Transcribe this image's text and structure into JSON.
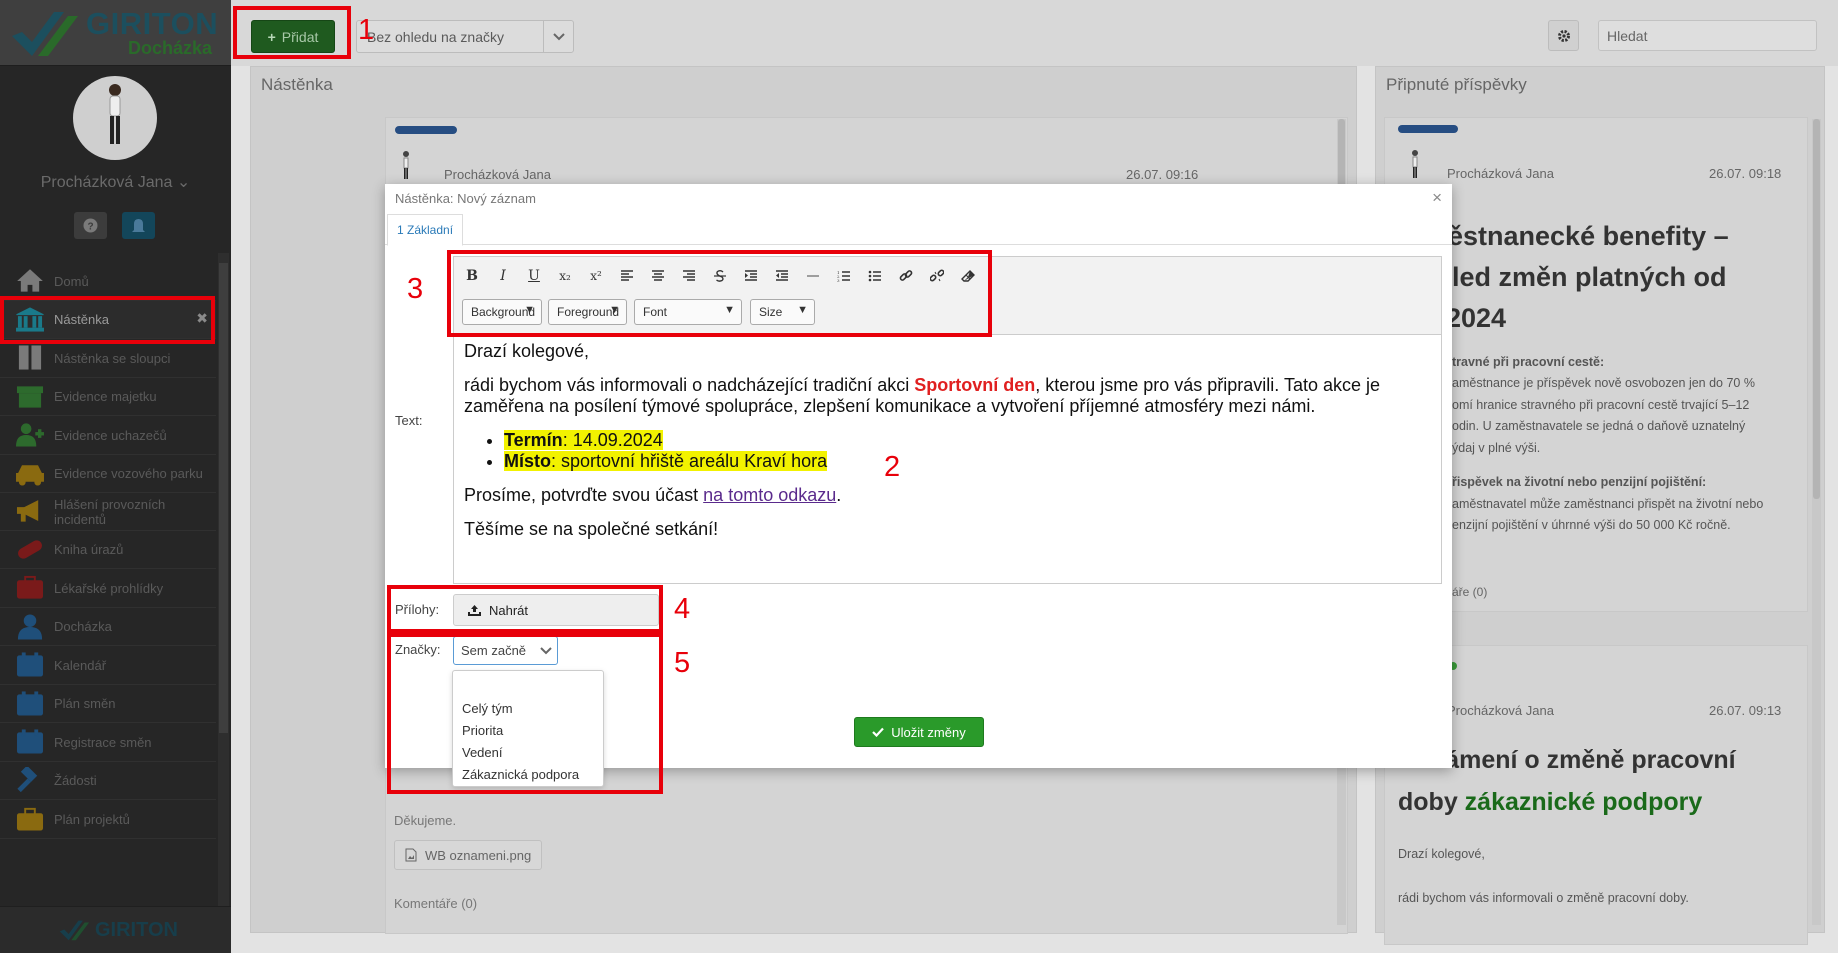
{
  "app": {
    "logo_name": "GIRITON",
    "logo_sub": "Docházka",
    "footer_logo": "GIRITON"
  },
  "user": {
    "name": "Procházková Jana",
    "chevron": "⌄"
  },
  "sidebar": {
    "items": [
      {
        "label": "Domů",
        "icon": "home-icon",
        "color": "#7a7a7a"
      },
      {
        "label": "Nástěnka",
        "icon": "bank-icon",
        "color": "#1a7a8a"
      },
      {
        "label": "Nástěnka se sloupci",
        "icon": "columns-icon",
        "color": "#7a7a7a"
      },
      {
        "label": "Evidence majetku",
        "icon": "box-icon",
        "color": "#2d6a2d"
      },
      {
        "label": "Evidence uchazečů",
        "icon": "user-add-icon",
        "color": "#2d6a2d"
      },
      {
        "label": "Evidence vozového parku",
        "icon": "car-icon",
        "color": "#8a6a10"
      },
      {
        "label": "Hlášení provozních incidentů",
        "icon": "megaphone-icon",
        "color": "#8a6a10"
      },
      {
        "label": "Kniha úrazů",
        "icon": "bandage-icon",
        "color": "#7a1a1a"
      },
      {
        "label": "Lékařské prohlídky",
        "icon": "medkit-icon",
        "color": "#7a1a1a"
      },
      {
        "label": "Docházka",
        "icon": "user-icon",
        "color": "#1f4f7a"
      },
      {
        "label": "Kalendář",
        "icon": "calendar-icon",
        "color": "#1f4f7a"
      },
      {
        "label": "Plán směn",
        "icon": "calendar-grid-icon",
        "color": "#1f4f7a"
      },
      {
        "label": "Registrace směn",
        "icon": "calendar-check-icon",
        "color": "#1f4f7a"
      },
      {
        "label": "Žádosti",
        "icon": "gavel-icon",
        "color": "#1f4f7a"
      },
      {
        "label": "Plán projektů",
        "icon": "briefcase-icon",
        "color": "#8a6a10"
      }
    ],
    "active_close": "✖"
  },
  "topbar": {
    "add_label": "Přidat",
    "tag_filter": "Bez ohledu na značky",
    "search_placeholder": "Hledat"
  },
  "board": {
    "title": "Nástěnka",
    "post": {
      "author": "Procházková Jana",
      "date": "26.07. 09:16"
    },
    "footer_line": "Děkujeme.",
    "attachment": "WB oznameni.png",
    "comments": "Komentáře (0)"
  },
  "pinned": {
    "title": "Připnuté příspěvky",
    "post1": {
      "author": "Procházková Jana",
      "date": "26.07. 09:18",
      "heading_lines": [
        "ěstnanecké benefity –",
        "led změn platných od",
        "2024"
      ],
      "p1_title": "travné při pracovní cestě:",
      "p1_lines": [
        "aměstnance je příspěvek nově osvobozen jen do 70 %",
        "omí hranice stravného při pracovní cestě trvající 5–12",
        "odin. U zaměstnavatele se jedná o daňově uznatelný",
        "ýdaj v plné výši."
      ],
      "p2_title": "řispěvek na životní nebo penzijní pojištění:",
      "p2_lines": [
        "aměstnavatel může zaměstnanci přispět na životní nebo",
        "enzijní pojištění v úhrnné výši do 50 000 Kč ročně."
      ],
      "comments": "áře (0)"
    },
    "post2": {
      "author": "Procházková Jana",
      "date": "26.07. 09:13",
      "heading_line1": "Oznámení o změně pracovní",
      "heading_line2_a": "doby ",
      "heading_line2_b": "zákaznické podpory",
      "greeting": "Drazí kolegové,",
      "body": "rádi bychom vás informovali o změně pracovní doby."
    }
  },
  "modal": {
    "title": "Nástěnka: Nový záznam",
    "close": "×",
    "tab": "1 Základní",
    "text_label": "Text:",
    "toolbar": {
      "buttons": [
        "B",
        "I",
        "U",
        "x₂",
        "x²"
      ],
      "selects": [
        "Background",
        "Foreground",
        "Font",
        "Size"
      ]
    },
    "content": {
      "greeting": "Drazí kolegové,",
      "p1_a": "rádi bychom vás informovali o nadcházející tradiční akci ",
      "p1_b": "Sportovní den",
      "p1_c": ", kterou jsme pro vás připravili. Tato akce je zaměřena na posílení týmové spolupráce, zlepšení komunikace a vytvoření příjemné atmosféry mezi námi.",
      "li1_label": "Termín",
      "li1_value": ": 14.09.2024",
      "li2_label": "Místo",
      "li2_value": ": sportovní hřiště areálu Kraví hora",
      "p2_a": "Prosíme, potvrďte svou účast ",
      "p2_link": "na tomto odkazu",
      "p2_c": ".",
      "closing": "Těšíme se na společné setkání!"
    },
    "attachments_label": "Přílohy:",
    "upload_label": "Nahrát",
    "tags_label": "Značky:",
    "tags_placeholder": "Sem začně",
    "tag_options": [
      "Celý tým",
      "Priorita",
      "Vedení",
      "Zákaznická podpora"
    ],
    "save_label": "Uložit změny"
  },
  "annotations": [
    "1",
    "2",
    "3",
    "4",
    "5"
  ],
  "colors": {
    "accent_red": "#e8000a",
    "save_green": "#2a9a2a",
    "link_purple": "#5a2a8c",
    "highlight_yellow": "#f2f200"
  }
}
